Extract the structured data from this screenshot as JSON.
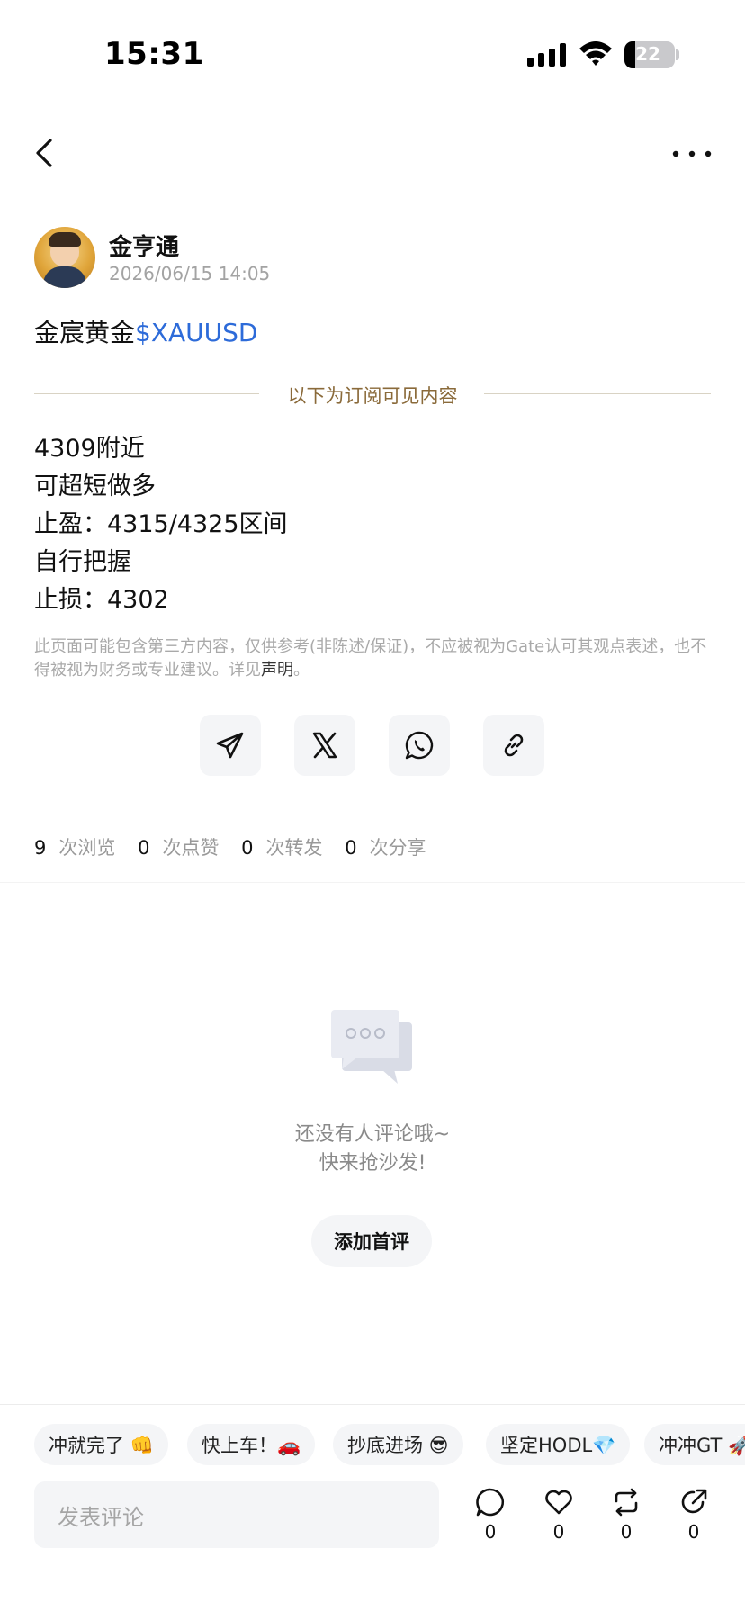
{
  "status_bar": {
    "time": "15:31",
    "battery": "22"
  },
  "author": {
    "name": "金亨通",
    "time": "2026/06/15 14:05"
  },
  "post": {
    "title_prefix": "金宸黄金",
    "title_tag": "$XAUUSD",
    "subscription_divider": "以下为订阅可见内容",
    "lines": [
      "4309附近",
      "可超短做多",
      "止盈：4315/4325区间",
      "自行把握",
      "止损：4302"
    ],
    "disclaimer_text": "此页面可能包含第三方内容，仅供参考(非陈述/保证)，不应被视为Gate认可其观点表述，也不得被视为财务或专业建议。详见",
    "disclaimer_link": "声明",
    "disclaimer_end": "。"
  },
  "share_icons": [
    "telegram-icon",
    "x-icon",
    "whatsapp-icon",
    "link-icon"
  ],
  "stats": {
    "views_count": "9",
    "views_label": "次浏览",
    "likes_count": "0",
    "likes_label": "次点赞",
    "reposts_count": "0",
    "reposts_label": "次转发",
    "shares_count": "0",
    "shares_label": "次分享"
  },
  "comments": {
    "empty_line1": "还没有人评论哦~",
    "empty_line2": "快来抢沙发!",
    "add_first_label": "添加首评"
  },
  "quick_replies": [
    "冲就完了 👊",
    "快上车！🚗",
    "抄底进场 😎",
    "坚定HODL💎",
    "冲冲GT 🚀"
  ],
  "bottom_bar": {
    "comment_placeholder": "发表评论",
    "comment_count": "0",
    "like_count": "0",
    "repost_count": "0",
    "share_count": "0"
  },
  "colors": {
    "accent_link": "#2d6bd9",
    "divider_text": "#8a6a3a"
  }
}
